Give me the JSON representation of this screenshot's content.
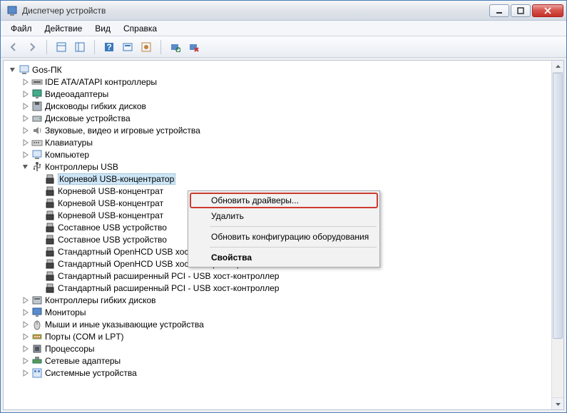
{
  "window": {
    "title": "Диспетчер устройств"
  },
  "menubar": [
    {
      "label": "Файл"
    },
    {
      "label": "Действие"
    },
    {
      "label": "Вид"
    },
    {
      "label": "Справка"
    }
  ],
  "tree": {
    "root": {
      "label": "Gos-ПК"
    },
    "categories": [
      {
        "label": "IDE ATA/ATAPI контроллеры",
        "icon": "ide"
      },
      {
        "label": "Видеоадаптеры",
        "icon": "display"
      },
      {
        "label": "Дисководы гибких дисков",
        "icon": "floppy"
      },
      {
        "label": "Дисковые устройства",
        "icon": "disk"
      },
      {
        "label": "Звуковые, видео и игровые устройства",
        "icon": "sound"
      },
      {
        "label": "Клавиатуры",
        "icon": "keyboard"
      },
      {
        "label": "Компьютер",
        "icon": "computer"
      }
    ],
    "usb_category": {
      "label": "Контроллеры USB"
    },
    "usb_items": [
      {
        "label": "Корневой USB-концентратор",
        "selected": true
      },
      {
        "label": "Корневой USB-концентрат"
      },
      {
        "label": "Корневой USB-концентрат"
      },
      {
        "label": "Корневой USB-концентрат"
      },
      {
        "label": "Составное USB устройство"
      },
      {
        "label": "Составное USB устройство"
      },
      {
        "label": "Стандартный OpenHCD USB хост-контроллер"
      },
      {
        "label": "Стандартный OpenHCD USB хост-контроллер"
      },
      {
        "label": "Стандартный расширенный PCI - USB хост-контроллер"
      },
      {
        "label": "Стандартный расширенный PCI - USB хост-контроллер"
      }
    ],
    "after_usb": [
      {
        "label": "Контроллеры гибких дисков",
        "icon": "floppyctrl"
      },
      {
        "label": "Мониторы",
        "icon": "monitor"
      },
      {
        "label": "Мыши и иные указывающие устройства",
        "icon": "mouse"
      },
      {
        "label": "Порты (COM и LPT)",
        "icon": "port"
      },
      {
        "label": "Процессоры",
        "icon": "cpu"
      },
      {
        "label": "Сетевые адаптеры",
        "icon": "network"
      },
      {
        "label": "Системные устройства",
        "icon": "system"
      }
    ]
  },
  "context_menu": {
    "items": [
      {
        "label": "Обновить драйверы...",
        "highlight": true
      },
      {
        "label": "Удалить"
      },
      {
        "sep": true
      },
      {
        "label": "Обновить конфигурацию оборудования"
      },
      {
        "sep": true
      },
      {
        "label": "Свойства",
        "bold": true
      }
    ]
  }
}
